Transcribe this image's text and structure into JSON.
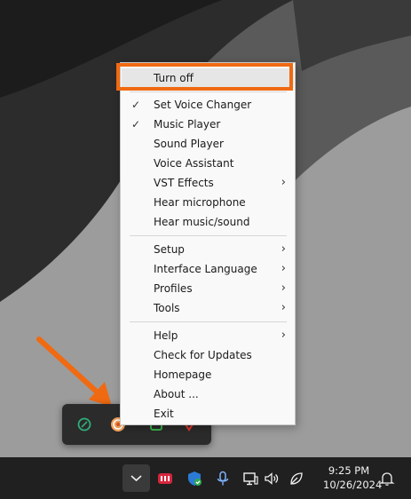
{
  "menu": {
    "groups": [
      [
        {
          "label": "Turn off",
          "checked": false,
          "submenu": false
        }
      ],
      [
        {
          "label": "Set Voice Changer",
          "checked": true,
          "submenu": false
        },
        {
          "label": "Music Player",
          "checked": true,
          "submenu": false
        },
        {
          "label": "Sound Player",
          "checked": false,
          "submenu": false
        },
        {
          "label": "Voice Assistant",
          "checked": false,
          "submenu": false
        },
        {
          "label": "VST Effects",
          "checked": false,
          "submenu": true
        },
        {
          "label": "Hear microphone",
          "checked": false,
          "submenu": false
        },
        {
          "label": "Hear music/sound",
          "checked": false,
          "submenu": false
        }
      ],
      [
        {
          "label": "Setup",
          "checked": false,
          "submenu": true
        },
        {
          "label": "Interface Language",
          "checked": false,
          "submenu": true
        },
        {
          "label": "Profiles",
          "checked": false,
          "submenu": true
        },
        {
          "label": "Tools",
          "checked": false,
          "submenu": true
        }
      ],
      [
        {
          "label": "Help",
          "checked": false,
          "submenu": true
        },
        {
          "label": "Check for Updates",
          "checked": false,
          "submenu": false
        },
        {
          "label": "Homepage",
          "checked": false,
          "submenu": false
        },
        {
          "label": "About ...",
          "checked": false,
          "submenu": false
        },
        {
          "label": "Exit",
          "checked": false,
          "submenu": false
        }
      ]
    ],
    "check_glyph": "✓",
    "submenu_glyph": "›"
  },
  "taskbar": {
    "time": "9:25 PM",
    "date": "10/26/2024",
    "tray_icons": [
      "chevron-up-icon",
      "red-app-icon",
      "security-shield-icon",
      "microphone-icon",
      "network-icon",
      "volume-icon",
      "battery-saver-icon",
      "notification-bell-icon"
    ]
  },
  "tray_flyout": {
    "icons": [
      "green-circle-icon",
      "voice-changer-icon",
      "green-app-icon",
      "red-app-icon"
    ]
  },
  "annotation": {
    "highlight_color": "#f06a12"
  }
}
